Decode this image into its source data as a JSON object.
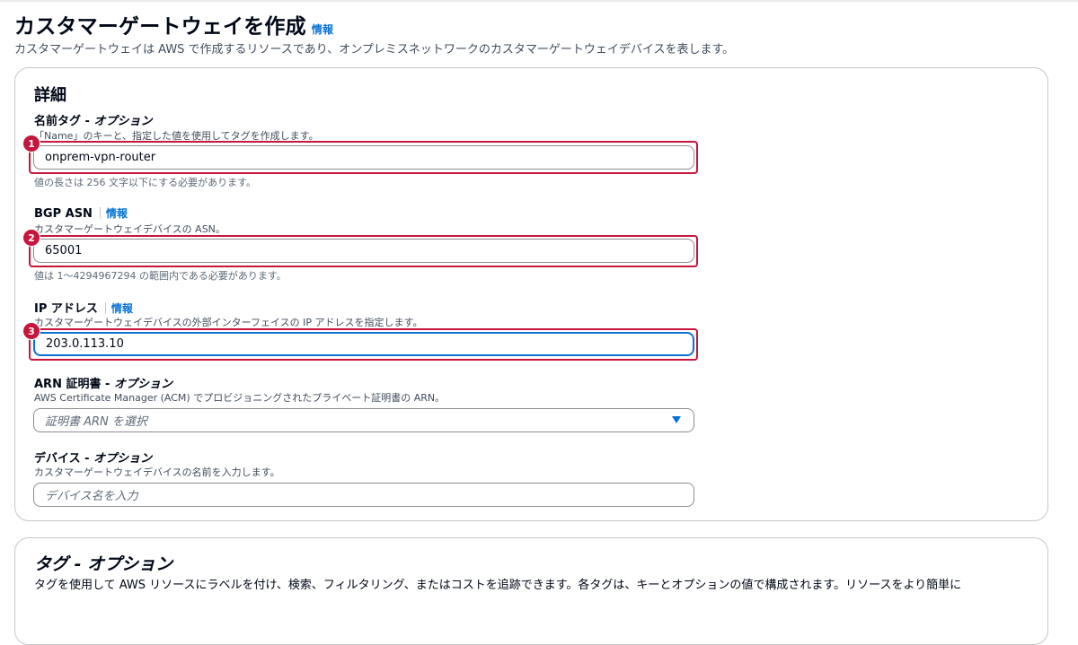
{
  "page": {
    "title": "カスタマーゲートウェイを作成",
    "info": "情報",
    "description": "カスタマーゲートウェイは AWS で作成するリソースであり、オンプレミスネットワークのカスタマーゲートウェイデバイスを表します。"
  },
  "details": {
    "title": "詳細",
    "name_tag": {
      "label": "名前タグ - ",
      "optional": "オプション",
      "description": "「Name」のキーと、指定した値を使用してタグを作成します。",
      "value": "onprem-vpn-router",
      "hint": "値の長さは 256 文字以下にする必要があります。",
      "badge": "1"
    },
    "bgp_asn": {
      "label": "BGP ASN",
      "info": "情報",
      "description": "カスタマーゲートウェイデバイスの ASN。",
      "value": "65001",
      "hint": "値は 1〜4294967294 の範囲内である必要があります。",
      "badge": "2"
    },
    "ip_address": {
      "label": "IP アドレス",
      "info": "情報",
      "description": "カスタマーゲートウェイデバイスの外部インターフェイスの IP アドレスを指定します。",
      "value": "203.0.113.10",
      "badge": "3"
    },
    "arn_cert": {
      "label": "ARN 証明書 - ",
      "optional": "オプション",
      "description": "AWS Certificate Manager (ACM) でプロビジョニングされたプライベート証明書の ARN。",
      "placeholder": "証明書 ARN を選択"
    },
    "device": {
      "label": "デバイス - ",
      "optional": "オプション",
      "description": "カスタマーゲートウェイデバイスの名前を入力します。",
      "placeholder": "デバイス名を入力"
    }
  },
  "tags": {
    "title": "タグ - オプション",
    "description": "タグを使用して AWS リソースにラベルを付け、検索、フィルタリング、またはコストを追跡できます。各タグは、キーとオプションの値で構成されます。リソースをより簡単に"
  },
  "colors": {
    "accent": "#0972d3",
    "highlight": "#c7153c"
  }
}
